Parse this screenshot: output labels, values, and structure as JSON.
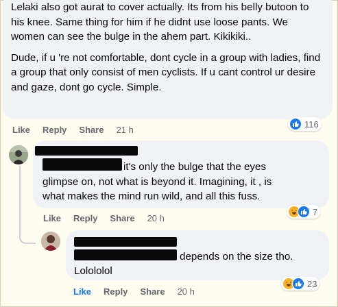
{
  "comments": [
    {
      "paragraphs": [
        "Lelaki also got aurat to cover actually. Its from his belly butoon to his knee. Same thing for him if he didnt use loose pants. We women can see the bulge in the ahem part. Kikikiki..",
        "Dude, if u 're not comfortable, dont cycle in a group with ladies, find a group that only consist of men cyclists. If u cant control ur desire and gaze, dont go cycle. Simple."
      ],
      "actions": {
        "like": "Like",
        "reply": "Reply",
        "share": "Share",
        "time": "21 h"
      },
      "reactions": {
        "icons": [
          "like-icon"
        ],
        "count": "116"
      }
    },
    {
      "line1": "it's only the bulge that the eyes",
      "line2": "glimpse on, not what is beyond it. Imagining, it , is",
      "line3": "what makes the mind run wild, and all this fuss.",
      "actions": {
        "like": "Like",
        "reply": "Reply",
        "share": "Share",
        "time": "20 h"
      },
      "reactions": {
        "icons": [
          "haha-icon",
          "like-icon"
        ],
        "count": "7"
      }
    },
    {
      "line1": "depends on the size tho.",
      "line2": "Lolololol",
      "actions": {
        "like": "Like",
        "reply": "Reply",
        "share": "Share",
        "time": "20 h"
      },
      "reactions": {
        "icons": [
          "haha-icon",
          "like-icon"
        ],
        "count": "23"
      }
    }
  ],
  "colors": {
    "like_active": "#1877f2",
    "bubble": "#f0f2f5",
    "meta": "#65676b",
    "background": "#fffdf0"
  }
}
